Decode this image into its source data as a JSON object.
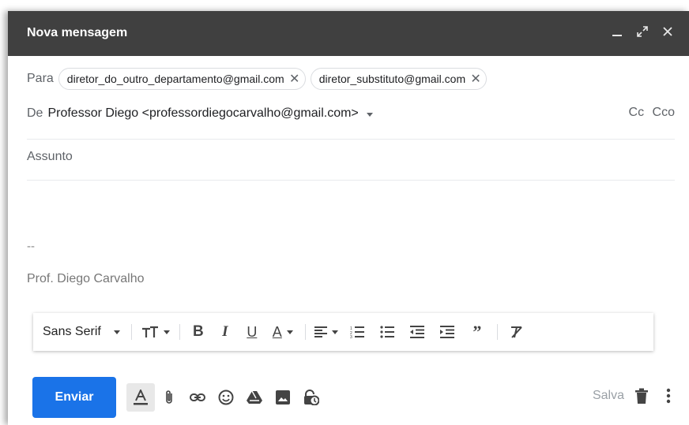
{
  "window": {
    "title": "Nova mensagem",
    "controls": [
      "minimize-icon",
      "expand-icon",
      "close-icon"
    ]
  },
  "recipients": {
    "label": "Para",
    "chips": [
      {
        "email": "diretor_do_outro_departamento@gmail.com"
      },
      {
        "email": "diretor_substituto@gmail.com"
      }
    ]
  },
  "from": {
    "label": "De",
    "value": "Professor Diego <professordiegocarvalho@gmail.com>",
    "cc_label": "Cc",
    "bcc_label": "Cco"
  },
  "subject": {
    "placeholder": "Assunto"
  },
  "signature": {
    "dash": "--",
    "name": "Prof. Diego Carvalho"
  },
  "format_toolbar": {
    "font_name": "Sans Serif",
    "items": [
      "font-size-icon",
      "bold-icon",
      "italic-icon",
      "underline-icon",
      "text-color-icon",
      "align-icon",
      "numbered-list-icon",
      "bulleted-list-icon",
      "indent-less-icon",
      "indent-more-icon",
      "quote-icon",
      "remove-formatting-icon"
    ]
  },
  "bottom_bar": {
    "send_label": "Enviar",
    "saved_label": "Salva",
    "accent": "#1a73e8"
  }
}
